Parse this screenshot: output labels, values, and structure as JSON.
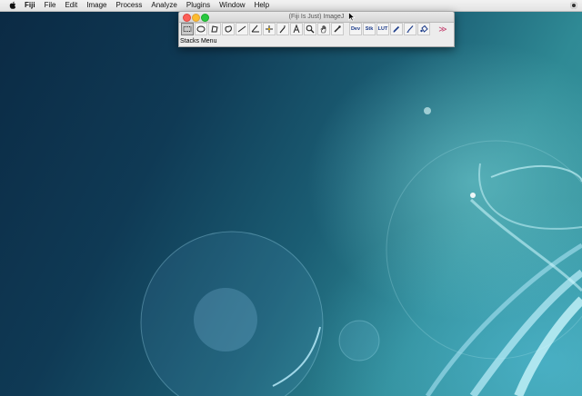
{
  "menubar": {
    "app_name": "Fiji",
    "items": [
      "File",
      "Edit",
      "Image",
      "Process",
      "Analyze",
      "Plugins",
      "Window",
      "Help"
    ]
  },
  "window": {
    "title": "(Fiji Is Just) ImageJ",
    "status_text": "Stacks Menu",
    "text_tools": {
      "dev": "Dev",
      "stk": "Stk",
      "lut": "LUT"
    },
    "more_glyph": "≫"
  },
  "icons": {
    "apple": "apple-logo-icon",
    "status": "menu-extra-status-icon",
    "tools": [
      "rectangle-icon",
      "oval-icon",
      "polygon-icon",
      "freehand-icon",
      "straight-line-icon",
      "angle-icon",
      "point-icon",
      "wand-icon",
      "text-icon",
      "magnifier-icon",
      "hand-icon",
      "color-picker-icon",
      "dev-icon",
      "stk-icon",
      "lut-icon",
      "pencil-icon",
      "brush-icon",
      "flood-fill-icon",
      "more-tools-icon"
    ]
  },
  "colors": {
    "close": "#fc5f57",
    "minimize": "#fdbc2e",
    "zoom": "#28c840",
    "desktop": "#1b5e74"
  }
}
